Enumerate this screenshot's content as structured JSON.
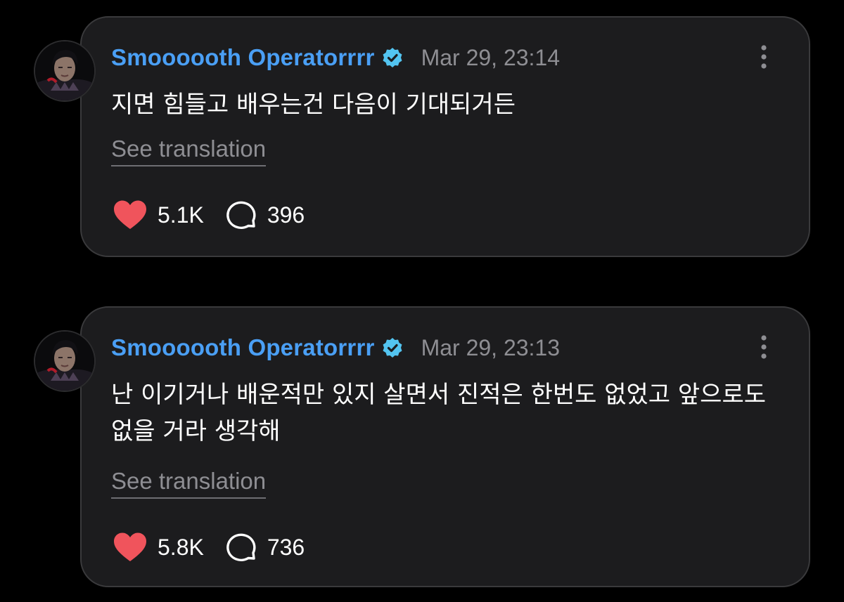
{
  "colors": {
    "background": "#000000",
    "card": "#1c1c1e",
    "card_border": "#3a3a3c",
    "username": "#4a9ff5",
    "verified_badge": "#53c4f0",
    "muted": "#8e8e93",
    "like": "#f0545c",
    "text": "#ffffff"
  },
  "posts": [
    {
      "username": "Smoooooth Operatorrrr",
      "verified_icon": "verified-badge-icon",
      "timestamp": "Mar 29, 23:14",
      "text": "지면 힘들고 배우는건 다음이 기대되거든",
      "see_translation": "See translation",
      "likes": "5.1K",
      "comments": "396"
    },
    {
      "username": "Smoooooth Operatorrrr",
      "verified_icon": "verified-badge-icon",
      "timestamp": "Mar 29, 23:13",
      "text": "난 이기거나 배운적만 있지 살면서 진적은 한번도 없었고 앞으로도 없을 거라 생각해",
      "see_translation": "See translation",
      "likes": "5.8K",
      "comments": "736"
    }
  ]
}
